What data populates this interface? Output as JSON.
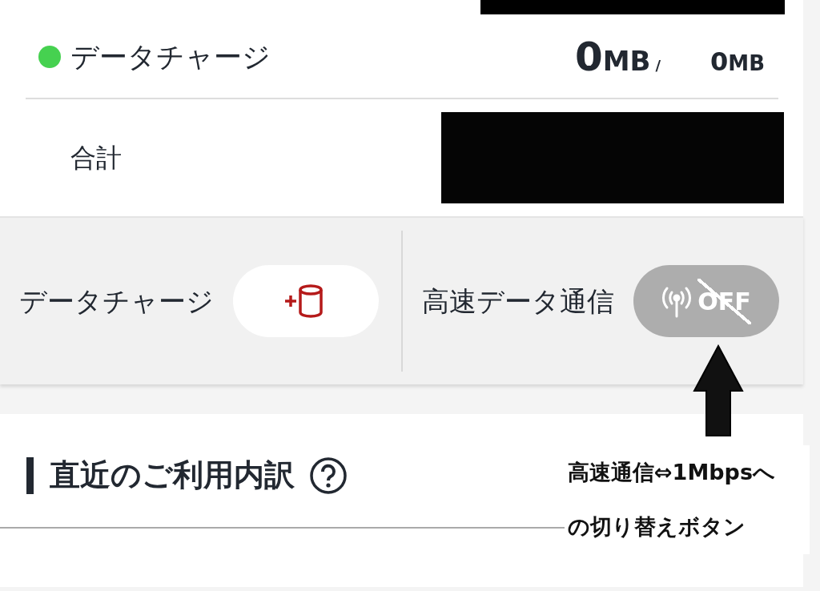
{
  "usage_rows": [
    {
      "kind": "usage",
      "label": "データチャージ",
      "color": "#46d150",
      "used": "0",
      "used_unit": "MB",
      "slash": "/",
      "total": "0",
      "total_unit": "MB"
    },
    {
      "kind": "total",
      "label": "合計",
      "redacted": true
    }
  ],
  "actions": {
    "charge": {
      "label": "データチャージ"
    },
    "high_speed": {
      "label": "高速データ通信",
      "toggle": {
        "on": false,
        "text": "OFF"
      }
    }
  },
  "recent": {
    "title": "直近のご利用内訳"
  },
  "annotation": {
    "lines": [
      "高速通信⇔1Mbpsへ",
      "の切り替えボタン"
    ]
  }
}
